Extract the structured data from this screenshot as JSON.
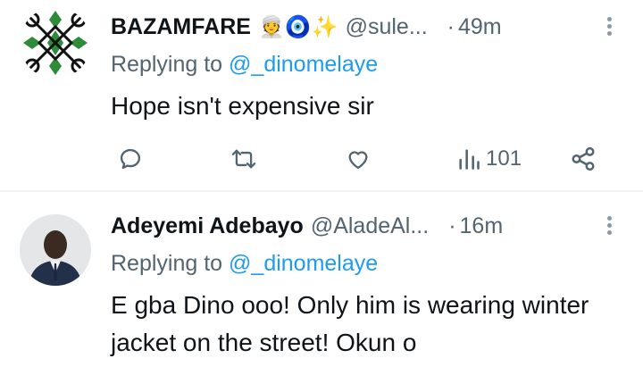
{
  "tweets": [
    {
      "name": "BAZAMFARE",
      "emojis": "👳🧿✨",
      "handle": "@sule...",
      "time": "49m",
      "replying_prefix": "Replying to",
      "replying_to": "@_dinomelaye",
      "text": "Hope isn't expensive sir",
      "actions": {
        "reply_icon": "reply-icon",
        "retweet_icon": "retweet-icon",
        "like_icon": "like-icon",
        "views_icon": "views-icon",
        "views_count": "101",
        "share_icon": "share-icon"
      }
    },
    {
      "name": "Adeyemi Adebayo",
      "handle": "@AladeAl...",
      "time": "16m",
      "replying_prefix": "Replying to",
      "replying_to": "@_dinomelaye",
      "text": "E gba Dino ooo! Only him is wearing winter jacket on the street! Okun o"
    }
  ],
  "colors": {
    "secondary_text": "#536471",
    "link": "#1d9bf0",
    "primary_text": "#0f1419",
    "logo_green": "#2e8b3a"
  }
}
